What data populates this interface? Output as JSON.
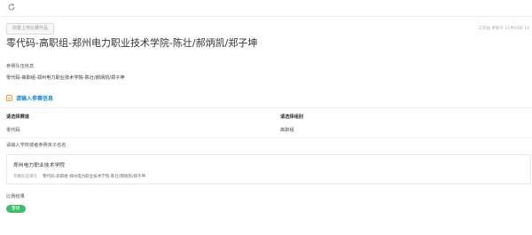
{
  "header": {
    "tag_label": "前置上传比赛作品",
    "meta_text": "工作站 更新于 11月04日 14"
  },
  "title": "零代码-高职组-郑州电力职业技术学院-陈壮/郝炳凯/郑子坤",
  "team": {
    "label": "参赛队伍信息",
    "value": "零代码-高职组-郑州电力职业技术学院-陈壮/郝炳凯/郑子坤"
  },
  "info": {
    "title": "请输入参赛信息",
    "track_label": "请选择赛道",
    "track_value": "零代码",
    "group_label": "请选择组别",
    "group_value": "高职组",
    "school_prompt": "请输入学校或者参赛床子名名",
    "school_name": "郑州电力职业技术学院",
    "school_sub_key": "参赛队伍填写",
    "school_sub_value": "零代码-高职组-郑州电力职业技术学院-陈壮/郝炳凯/郑子坤"
  },
  "result": {
    "label": "比赛结果",
    "badge": "晋级"
  },
  "colors": {
    "accent": "#1a8dd6",
    "success": "#3bbf6b",
    "icon_orange": "#f0a020"
  }
}
